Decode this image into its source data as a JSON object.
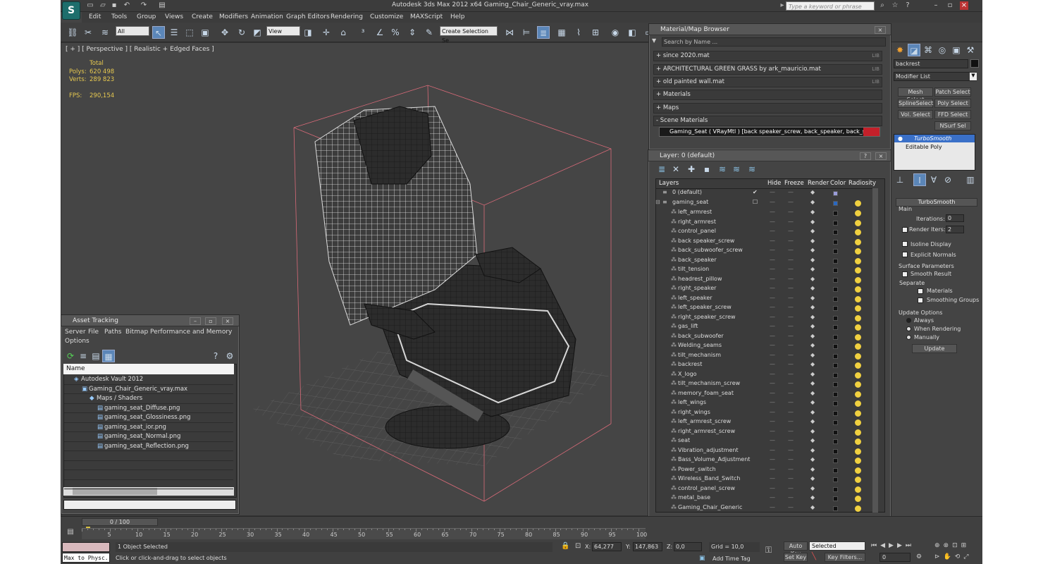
{
  "app": {
    "title": "Autodesk 3ds Max  2012 x64     Gaming_Chair_Generic_vray.max",
    "search_placeholder": "Type a keyword or phrase",
    "logo": "S"
  },
  "menu": [
    "Edit",
    "Tools",
    "Group",
    "Views",
    "Create",
    "Modifiers",
    "Animation",
    "Graph Editors",
    "Rendering",
    "Customize",
    "MAXScript",
    "Help"
  ],
  "toolbar": {
    "selection_filter": "All",
    "ref_coord": "View",
    "named_selection": "Create Selection Se"
  },
  "viewport": {
    "label": "[ + ] [ Perspective ] [ Realistic + Edged Faces ]",
    "stats_header": "Total",
    "polys_label": "Polys:",
    "polys": "620 498",
    "verts_label": "Verts:",
    "verts": "289 823",
    "fps_label": "FPS:",
    "fps": "290,154"
  },
  "material_browser": {
    "title": "Material/Map Browser",
    "search_placeholder": "Search by Name ...",
    "rows": [
      {
        "label": "+ since 2020.mat",
        "tag": "LIB"
      },
      {
        "label": "+ ARCHITECTURAL GREEN GRASS by ark_mauricio.mat",
        "tag": "LIB"
      },
      {
        "label": "+ old painted wall.mat",
        "tag": "LIB"
      },
      {
        "label": "+ Materials",
        "tag": ""
      },
      {
        "label": "+ Maps",
        "tag": ""
      },
      {
        "label": "- Scene Materials",
        "tag": ""
      }
    ],
    "scene_material": "Gaming_Seat  ( VRayMtl ) [back speaker_screw, back_speaker, back_subwoofer..."
  },
  "layer_dialog": {
    "title": "Layer: 0 (default)",
    "columns": {
      "layers": "Layers",
      "hide": "Hide",
      "freeze": "Freeze",
      "render": "Render",
      "color": "Color",
      "radiosity": "Radiosity"
    },
    "default_layer": "0 (default)",
    "parent": "gaming_seat",
    "objects": [
      "left_armrest",
      "right_armrest",
      "control_panel",
      "back speaker_screw",
      "back_subwoofer_screw",
      "back_speaker",
      "tilt_tension",
      "headrest_pillow",
      "right_speaker",
      "left_speaker",
      "left_speaker_screw",
      "right_speaker_screw",
      "gas_lift",
      "back_subwoofer",
      "Welding_seams",
      "tilt_mechanism",
      "backrest",
      "X_logo",
      "tilt_mechanism_screw",
      "memory_foam_seat",
      "left_wings",
      "right_wings",
      "left_armrest_screw",
      "right_armrest_screw",
      "seat",
      "Vibration_adjustment",
      "Bass_Volume_Adjustment",
      "Power_switch",
      "Wireless_Band_Switch",
      "control_panel_screw",
      "metal_base",
      "Gaming_Chair_Generic"
    ]
  },
  "asset_tracking": {
    "title": "Asset Tracking",
    "menu": [
      "Server",
      "File",
      "Paths",
      "Bitmap Performance and Memory"
    ],
    "menu2": "Options",
    "column": "Name",
    "rows": [
      {
        "label": "Autodesk Vault 2012",
        "indent": 0
      },
      {
        "label": "Gaming_Chair_Generic_vray.max",
        "indent": 1
      },
      {
        "label": "Maps / Shaders",
        "indent": 2
      },
      {
        "label": "gaming_seat_Diffuse.png",
        "indent": 3
      },
      {
        "label": "gaming_seat_Glossiness.png",
        "indent": 3
      },
      {
        "label": "gaming_seat_ior.png",
        "indent": 3
      },
      {
        "label": "gaming_seat_Normal.png",
        "indent": 3
      },
      {
        "label": "gaming_seat_Reflection.png",
        "indent": 3
      }
    ]
  },
  "command_panel": {
    "object_name": "backrest",
    "modifier_list": "Modifier List",
    "buttons": [
      "Mesh Select",
      "Patch Select",
      "SplineSelect",
      "Poly Select",
      "Vol. Select",
      "FFD Select",
      "NSurf Sel"
    ],
    "stack": [
      "TurboSmooth",
      "Editable Poly"
    ],
    "rollout": "TurboSmooth",
    "main": "Main",
    "iterations_label": "Iterations:",
    "iterations": "0",
    "render_iters_label": "Render Iters:",
    "render_iters": "2",
    "isoline": "Isoline Display",
    "explicit": "Explicit Normals",
    "surface": "Surface Parameters",
    "smooth_result": "Smooth Result",
    "separate": "Separate",
    "materials": "Materials",
    "smoothing": "Smoothing Groups",
    "update_options": "Update Options",
    "always": "Always",
    "when_rendering": "When Rendering",
    "manually": "Manually",
    "update": "Update"
  },
  "timeline": {
    "frame": "0 / 100",
    "ticks": [
      "0",
      "5",
      "10",
      "15",
      "20",
      "25",
      "30",
      "35",
      "40",
      "45",
      "50",
      "55",
      "60",
      "65",
      "70",
      "75",
      "80",
      "85",
      "90",
      "95",
      "100"
    ]
  },
  "status": {
    "maxscript": "Max to Physc.",
    "selected": "1 Object Selected",
    "prompt": "Click or click-and-drag to select objects",
    "x_label": "X:",
    "x": "64,277",
    "y_label": "Y:",
    "y": "147,863",
    "z_label": "Z:",
    "z": "0,0",
    "grid": "Grid = 10,0",
    "add_time_tag": "Add Time Tag",
    "auto_key": "Auto Key",
    "set_key": "Set Key",
    "key_mode": "Selected",
    "key_filters": "Key Filters...",
    "frame_field": "0"
  }
}
